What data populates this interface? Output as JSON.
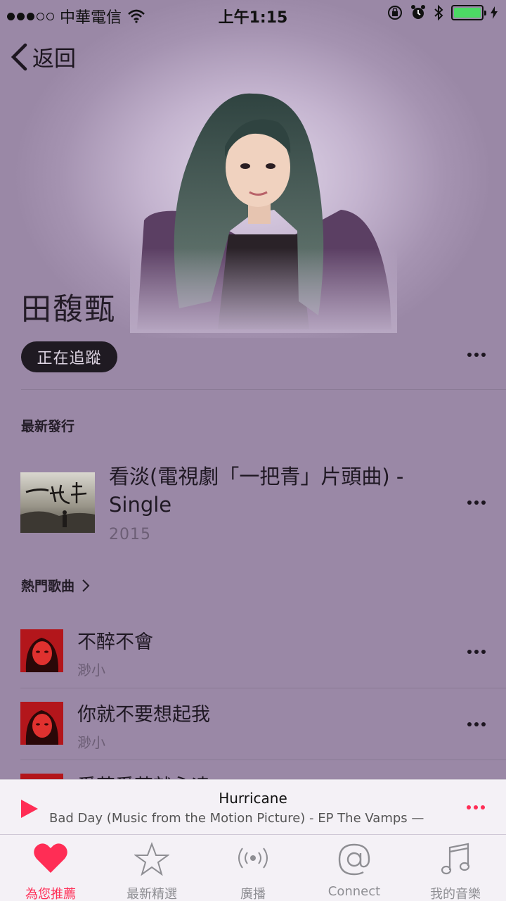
{
  "status_bar": {
    "carrier": "中華電信",
    "time": "上午1:15",
    "battery_color": "#4cd964"
  },
  "nav": {
    "back_label": "返回"
  },
  "artist": {
    "name": "田馥甄",
    "follow_label": "正在追蹤"
  },
  "latest_release": {
    "section_title": "最新發行",
    "title": "看淡(電視劇「一把青」片頭曲) - Single",
    "year": "2015",
    "art_text": "一把青"
  },
  "top_songs": {
    "section_title": "熱門歌曲",
    "items": [
      {
        "title": "不醉不會",
        "album": "渺小"
      },
      {
        "title": "你就不要想起我",
        "album": "渺小"
      },
      {
        "title": "愛著愛著就永遠",
        "album": ""
      }
    ]
  },
  "now_playing": {
    "title": "Hurricane",
    "subtitle": "Bad Day (Music from the Motion Picture) - EP   The Vamps — ",
    "accent_color": "#ff2d55"
  },
  "tab_bar": {
    "tabs": [
      {
        "label": "為您推薦",
        "icon": "heart-icon",
        "active": true
      },
      {
        "label": "最新精選",
        "icon": "star-icon",
        "active": false
      },
      {
        "label": "廣播",
        "icon": "radio-icon",
        "active": false
      },
      {
        "label": "Connect",
        "icon": "connect-icon",
        "active": false
      },
      {
        "label": "我的音樂",
        "icon": "music-note-icon",
        "active": false
      }
    ]
  }
}
